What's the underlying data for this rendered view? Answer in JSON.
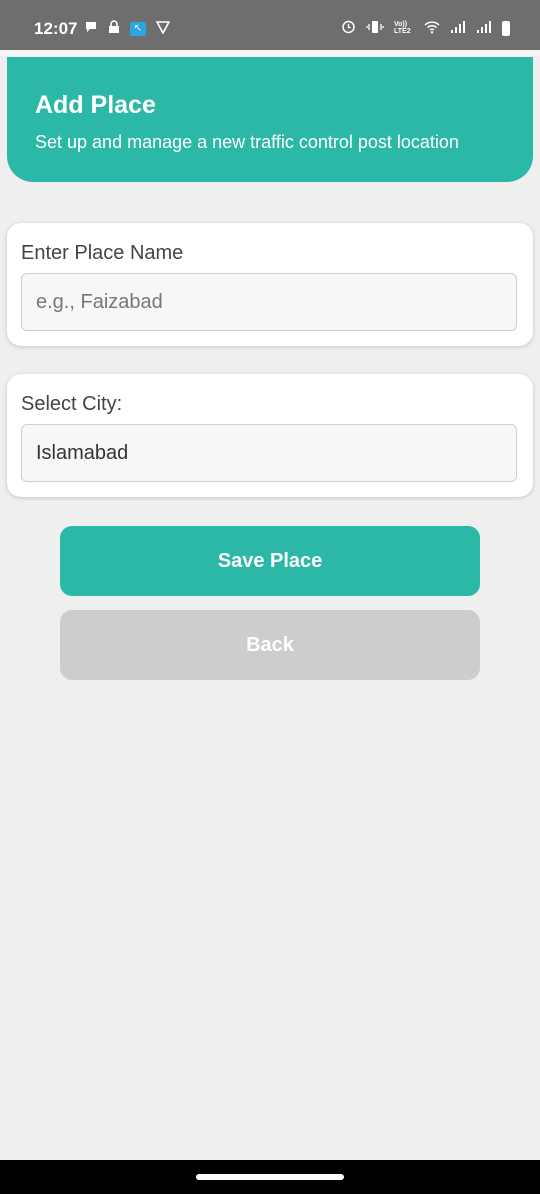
{
  "status_bar": {
    "time": "12:07",
    "icons": [
      "chat-bubble-icon",
      "lock-icon",
      "app-icon",
      "shield-icon",
      "alarm-icon",
      "vibrate-icon",
      "volte-icon",
      "wifi-icon",
      "signal-icon",
      "signal-icon-2",
      "battery-icon"
    ],
    "volte_text": "Vo)) LTE2"
  },
  "header": {
    "title": "Add Place",
    "subtitle": "Set up and manage a new traffic control post location",
    "bg_color": "#2cb8a7"
  },
  "place_card": {
    "label": "Enter Place Name",
    "placeholder": "e.g., Faizabad",
    "value": ""
  },
  "city_card": {
    "label": "Select City:",
    "selected": "Islamabad"
  },
  "buttons": {
    "save": "Save Place",
    "back": "Back"
  },
  "colors": {
    "accent": "#2cb8a7",
    "disabled": "#cdcdcd",
    "background": "#efefef"
  }
}
